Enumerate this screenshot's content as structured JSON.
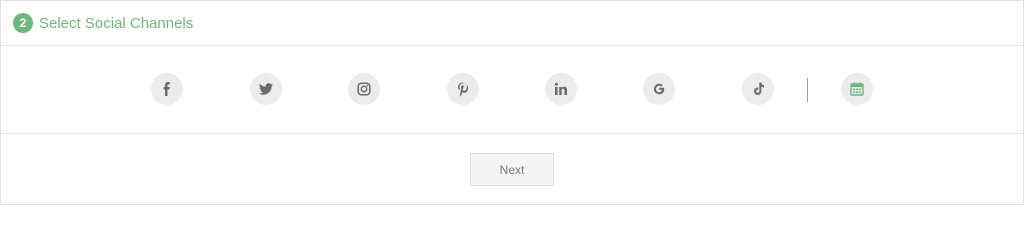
{
  "step": {
    "number": "2",
    "title": "Select Social Channels"
  },
  "channels": [
    {
      "icon": "facebook-icon"
    },
    {
      "icon": "twitter-icon"
    },
    {
      "icon": "instagram-icon"
    },
    {
      "icon": "pinterest-icon"
    },
    {
      "icon": "linkedin-icon"
    },
    {
      "icon": "google-icon"
    },
    {
      "icon": "tiktok-icon"
    },
    {
      "icon": "calendar-icon"
    }
  ],
  "actions": {
    "next_label": "Next"
  },
  "colors": {
    "accent": "#6cb87a",
    "icon": "#6b6b6b",
    "icon_bg": "#ececec"
  }
}
